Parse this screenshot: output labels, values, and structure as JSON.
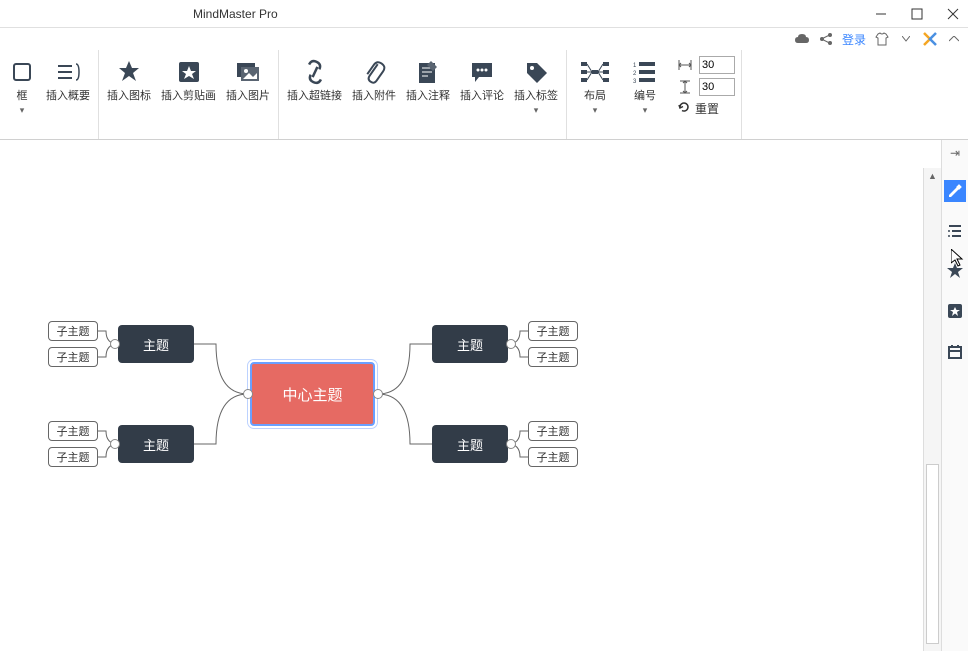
{
  "app": {
    "title": "MindMaster Pro"
  },
  "account": {
    "login_label": "登录"
  },
  "ribbon": {
    "g1": [
      {
        "label": "框"
      },
      {
        "label": "插入概要"
      }
    ],
    "g2": [
      {
        "label": "插入图标"
      },
      {
        "label": "插入剪贴画"
      },
      {
        "label": "插入图片"
      }
    ],
    "g3": [
      {
        "label": "插入超链接"
      },
      {
        "label": "插入附件"
      },
      {
        "label": "插入注释"
      },
      {
        "label": "插入评论"
      },
      {
        "label": "插入标签"
      }
    ],
    "g4": [
      {
        "label": "布局"
      },
      {
        "label": "编号"
      }
    ],
    "spacing": {
      "h": "30",
      "v": "30",
      "reset_label": "重置"
    }
  },
  "mindmap": {
    "center": "中心主题",
    "topics": [
      "主题",
      "主题",
      "主题",
      "主题"
    ],
    "subs": [
      "子主题",
      "子主题",
      "子主题",
      "子主题",
      "子主题",
      "子主题",
      "子主题",
      "子主题"
    ]
  }
}
